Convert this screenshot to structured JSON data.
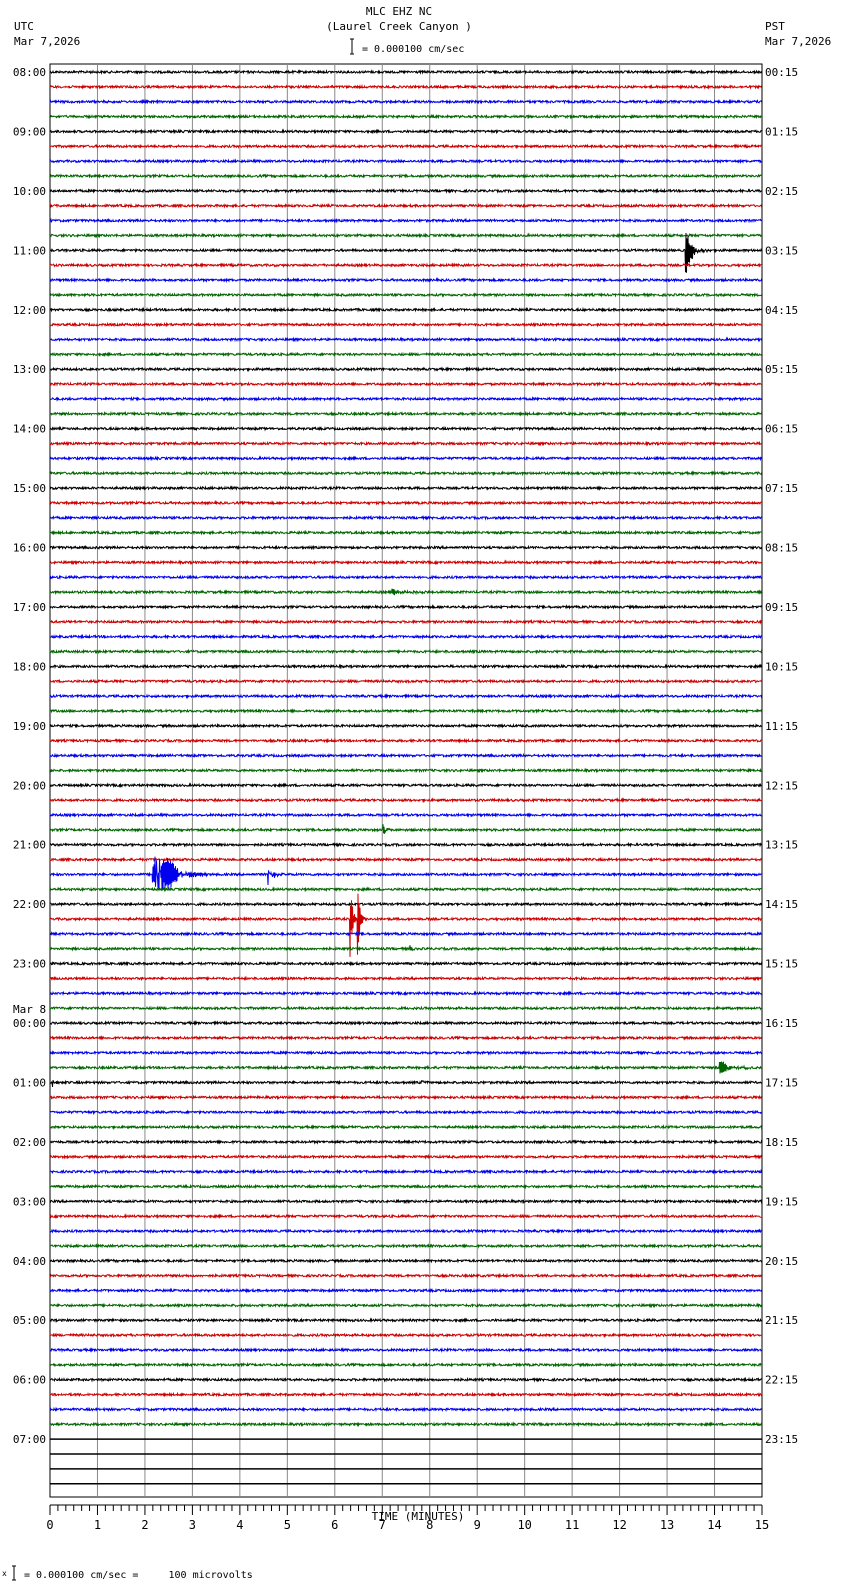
{
  "chart_data": {
    "type": "line",
    "title": "MLC EHZ NC",
    "subtitle": "(Laurel Creek Canyon )",
    "left_timezone": "UTC",
    "left_date": "Mar 7,2026",
    "right_timezone": "PST",
    "right_date": "Mar 7,2026",
    "scale_label": "= 0.000100 cm/sec",
    "footer_scale_label": "= 0.000100 cm/sec =     100 microvolts",
    "footer_mark": "x",
    "xlabel": "TIME (MINUTES)",
    "xlim": [
      0,
      15
    ],
    "x_ticks": [
      "0",
      "1",
      "2",
      "3",
      "4",
      "5",
      "6",
      "7",
      "8",
      "9",
      "10",
      "11",
      "12",
      "13",
      "14",
      "15"
    ],
    "traces_per_hour": 4,
    "trace_colors": [
      "#000000",
      "#cc0000",
      "#0000ee",
      "#006600"
    ],
    "recorded_traces": 92,
    "total_traces": 96,
    "date_change": {
      "label": "Mar 8",
      "before_hour_index": 16
    },
    "left_labels": [
      "08:00",
      "09:00",
      "10:00",
      "11:00",
      "12:00",
      "13:00",
      "14:00",
      "15:00",
      "16:00",
      "17:00",
      "18:00",
      "19:00",
      "20:00",
      "21:00",
      "22:00",
      "23:00",
      "00:00",
      "01:00",
      "02:00",
      "03:00",
      "04:00",
      "05:00",
      "06:00",
      "07:00"
    ],
    "right_labels": [
      "00:15",
      "01:15",
      "02:15",
      "03:15",
      "04:15",
      "05:15",
      "06:15",
      "07:15",
      "08:15",
      "09:15",
      "10:15",
      "11:15",
      "12:15",
      "13:15",
      "14:15",
      "15:15",
      "16:15",
      "17:15",
      "18:15",
      "19:15",
      "20:15",
      "21:15",
      "22:15",
      "23:15"
    ],
    "events": [
      {
        "trace": 12,
        "minute": 13.38,
        "amplitude": 2.0,
        "duration": 0.5
      },
      {
        "trace": 35,
        "minute": 7.2,
        "amplitude": 0.35,
        "duration": 0.9
      },
      {
        "trace": 47,
        "minute": 14.72,
        "amplitude": 0.4,
        "duration": 0.1
      },
      {
        "trace": 51,
        "minute": 7.01,
        "amplitude": 0.9,
        "duration": 0.2
      },
      {
        "trace": 54,
        "minute": 2.15,
        "amplitude": 3.4,
        "duration": 1.2
      },
      {
        "trace": 54,
        "minute": 4.59,
        "amplitude": 1.2,
        "duration": 0.3
      },
      {
        "trace": 57,
        "minute": 6.32,
        "amplitude": 4.2,
        "duration": 0.15
      },
      {
        "trace": 57,
        "minute": 6.47,
        "amplitude": 3.8,
        "duration": 0.2
      },
      {
        "trace": 59,
        "minute": 7.58,
        "amplitude": 0.3,
        "duration": 0.1
      },
      {
        "trace": 67,
        "minute": 14.1,
        "amplitude": 0.6,
        "duration": 0.9
      },
      {
        "trace": 68,
        "minute": 0.05,
        "amplitude": 0.4,
        "duration": 0.3
      },
      {
        "trace": 68,
        "minute": 7.82,
        "amplitude": 0.7,
        "duration": 0.15
      }
    ]
  }
}
